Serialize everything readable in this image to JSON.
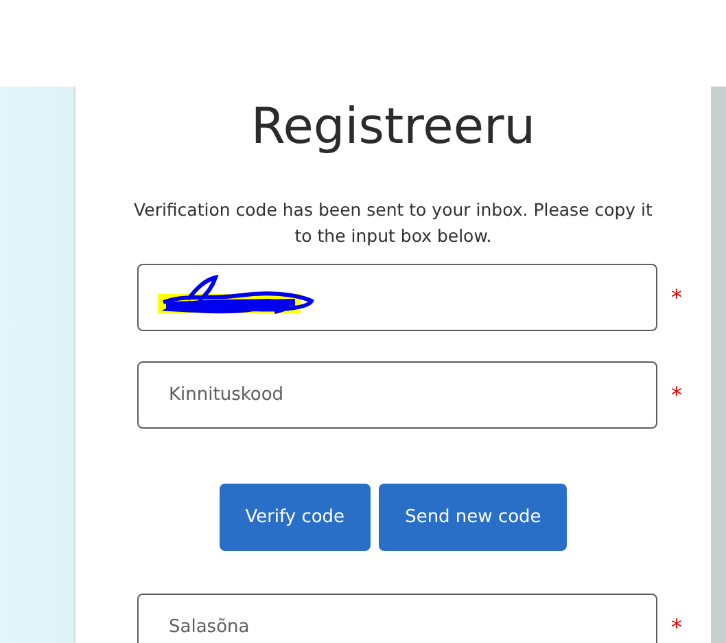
{
  "title": "Registreeru",
  "message": "Verification code has been sent to your inbox. Please copy it to the input box below.",
  "fields": [
    {
      "kind": "redacted",
      "required_mark": "*"
    },
    {
      "kind": "placeholder",
      "placeholder": "Kinnituskood",
      "required_mark": "*"
    }
  ],
  "buttons": [
    "Verify code",
    "Send new code"
  ],
  "fields_after": [
    {
      "kind": "placeholder",
      "placeholder": "Salasõna",
      "required_mark": "*"
    }
  ]
}
